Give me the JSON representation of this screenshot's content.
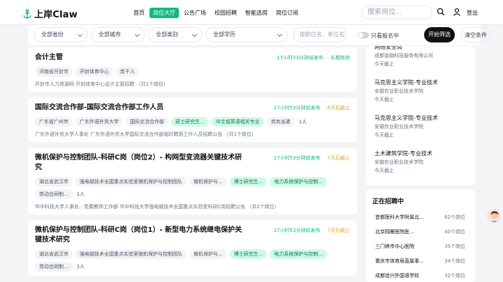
{
  "brand": {
    "name": "上岸Claw"
  },
  "nav": [
    "首页",
    "岗位大厅",
    "公告广场",
    "校园招聘",
    "智能选岗",
    "岗位订阅"
  ],
  "search": {
    "placeholder": "搜索岗位..."
  },
  "header": {
    "logout": "登出"
  },
  "filters": {
    "province": "全部省份",
    "city": "全部城市",
    "category": "全部类别",
    "education": "全部学历",
    "keyword_placeholder": "按职位名、单位名...",
    "only_open": "只看报名中",
    "submit": "开始筛选",
    "clear": "清空条件"
  },
  "jobs": [
    {
      "title": "会计主管",
      "time": "17小时53分钟前发布",
      "deadline": "长期有效",
      "tags": [
        {
          "text": "河南省开封市",
          "style": "gray"
        },
        {
          "text": "开封体育中心",
          "style": "gray"
        },
        {
          "text": "若干人",
          "style": "gray"
        }
      ],
      "footer": "开封市人力资源网  开封体育中心会计主管招聘  （共1个岗位）"
    },
    {
      "title": "国际交流合作部-国际交流合作部工作人员",
      "time": "17小时53分钟前发布",
      "deadline": "6天后截止",
      "tags": [
        {
          "text": "广东省广州市",
          "style": "gray"
        },
        {
          "text": "广东外语外贸大学",
          "style": "gray"
        },
        {
          "text": "国际交流合作部",
          "style": "gray"
        },
        {
          "text": "硕士研究生...",
          "style": "green"
        },
        {
          "text": "中文或英语相关专业",
          "style": "green"
        },
        {
          "text": "劳务派遣",
          "style": "gray"
        },
        {
          "text": "1人",
          "style": "plain"
        }
      ],
      "footer": "广东外语外贸大学人事处  广东外语外贸大学国际交流合作部临时聘用工作人员招聘公告  （共1个岗位）"
    },
    {
      "title": "微机保护与控制团队-科研C岗（岗位2）- 构网型变流器关键技术研究",
      "time": "17小时53分钟前发布",
      "deadline": "7天后截止",
      "tags": [
        {
          "text": "湖北省武汉市",
          "style": "gray"
        },
        {
          "text": "强电磁技术全国重点实验室微机保护与控制团队",
          "style": "gray"
        },
        {
          "text": "微机保护与...",
          "style": "gray"
        },
        {
          "text": "博士研究生...",
          "style": "green"
        },
        {
          "text": "电力系统保护与控制...",
          "style": "green"
        },
        {
          "text": "劳动合同制...",
          "style": "gray"
        },
        {
          "text": "1人",
          "style": "plain"
        }
      ],
      "footer": "华中科技大学人事处、党委教师工作部  华中科技大学强电磁技术全国重点实验室科研C岗招聘公告  （共2个岗位）"
    },
    {
      "title": "微机保护与控制团队-科研C岗（岗位1）- 新型电力系统继电保护关键技术研究",
      "time": "17小时53分钟前发布",
      "deadline": "7天后截止",
      "tags": [
        {
          "text": "湖北省武汉市",
          "style": "gray"
        },
        {
          "text": "强电磁技术全国重点实验室微机保护与控制团队",
          "style": "gray"
        },
        {
          "text": "微机保护与...",
          "style": "gray"
        },
        {
          "text": "博士研究生...",
          "style": "green"
        },
        {
          "text": "电力系统保护与控制...",
          "style": "green"
        },
        {
          "text": "劳动合同制...",
          "style": "gray"
        },
        {
          "text": "1人",
          "style": "plain"
        }
      ],
      "footer": ""
    }
  ],
  "side_notices": [
    {
      "title": "网络安全岗",
      "sub": "成都金融科技服务有限公司",
      "date": "今天截止"
    },
    {
      "title": "马克思主义学院-专业技术",
      "sub": "安徽农业职业技术学院",
      "date": "今天截止"
    },
    {
      "title": "马克思主义学院-专业技术",
      "sub": "安徽农业职业技术学院",
      "date": "今天截止"
    },
    {
      "title": "土木建筑学院-专业技术",
      "sub": "安徽农业职业技术学院",
      "date": "今天截止"
    }
  ],
  "hiring": {
    "title": "正在招聘中",
    "items": [
      {
        "name": "首都医科大学附属北...",
        "count": "62个岗位"
      },
      {
        "name": "北京翔雁医院医...",
        "count": "40个岗位"
      },
      {
        "name": "三门峡市中心医院",
        "count": "35个岗位"
      },
      {
        "name": "重庆市体育局直属事...",
        "count": "34个岗位"
      },
      {
        "name": "成都佳兴外国语学校",
        "count": "32个岗位"
      }
    ]
  }
}
